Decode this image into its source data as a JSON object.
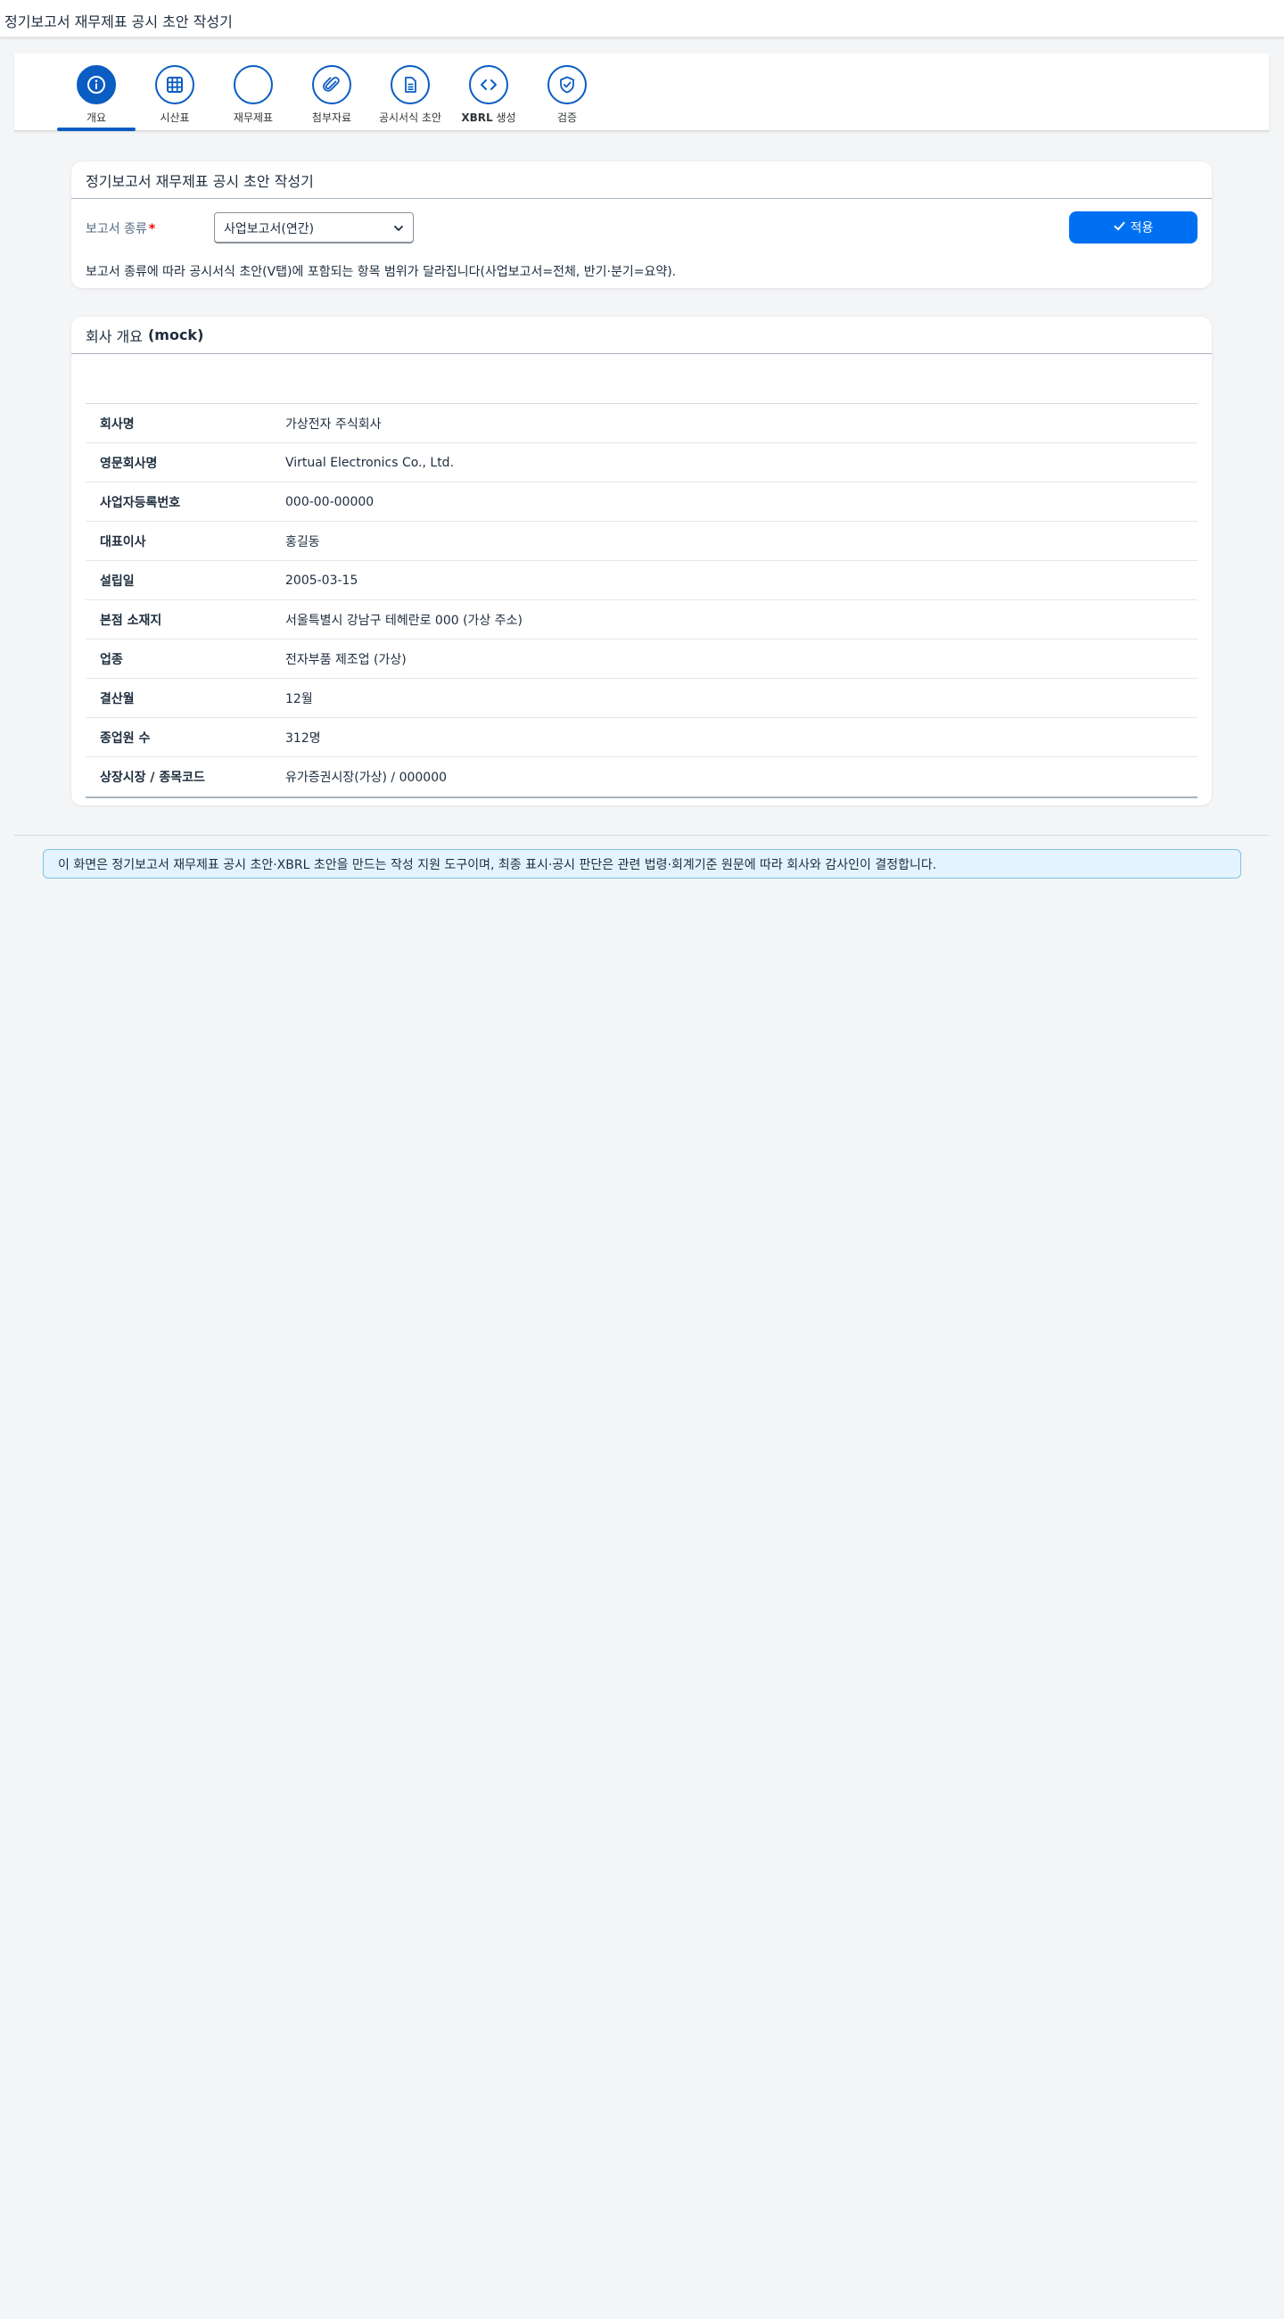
{
  "shell": {
    "title": "정기보고서 재무제표 공시 초안 작성기"
  },
  "wizard": {
    "steps": [
      {
        "label": "개요",
        "icon": "info-icon",
        "active": true
      },
      {
        "label": "시산표",
        "icon": "grid-table-icon",
        "active": false
      },
      {
        "label": "재무제표",
        "icon": "empty-circle-icon",
        "active": false
      },
      {
        "label": "첨부자료",
        "icon": "paperclip-icon",
        "active": false
      },
      {
        "label": "공시서식 초안",
        "icon": "document-icon",
        "active": false
      },
      {
        "label_bold": "XBRL",
        "label": " 생성",
        "icon": "code-icon",
        "active": false
      },
      {
        "label": "검증",
        "icon": "shield-check-icon",
        "active": false
      }
    ]
  },
  "report_card": {
    "title": "정기보고서 재무제표 공시 초안 작성기",
    "field_label": "보고서 종류",
    "required_mark": "*",
    "selected_value": "사업보고서(연간)",
    "apply_label": "적용",
    "hint": "보고서 종류에 따라 공시서식 초안(Ⅴ탭)에 포함되는 항목 범위가 달라집니다(사업보고서=전체, 반기·분기=요약)."
  },
  "company_card": {
    "title": "회사 개요",
    "title_suffix": "(mock)",
    "rows": [
      {
        "key": "회사명",
        "value": "가상전자 주식회사"
      },
      {
        "key": "영문회사명",
        "value": "Virtual Electronics Co., Ltd."
      },
      {
        "key": "사업자등록번호",
        "value": "000-00-00000"
      },
      {
        "key": "대표이사",
        "value": "홍길동"
      },
      {
        "key": "설립일",
        "value": "2005-03-15"
      },
      {
        "key": "본점 소재지",
        "value": "서울특별시 강남구 테헤란로 000 (가상 주소)"
      },
      {
        "key": "업종",
        "value": "전자부품 제조업 (가상)"
      },
      {
        "key": "결산월",
        "value": "12월"
      },
      {
        "key": "종업원 수",
        "value": "312명"
      },
      {
        "key": "상장시장 / 종목코드",
        "value": "유가증권시장(가상) / 000000"
      }
    ]
  },
  "notice": "이 화면은 정기보고서 재무제표 공시 초안·XBRL 초안을 만드는 작성 지원 도구이며, 최종 표시·공시 판단은 관련 법령·회계기준 원문에 따라 회사와 감사인이 결정합니다.",
  "colors": {
    "accent": "#0a5dc2",
    "button": "#0070f2",
    "notice_bg": "#e4f4ff"
  }
}
